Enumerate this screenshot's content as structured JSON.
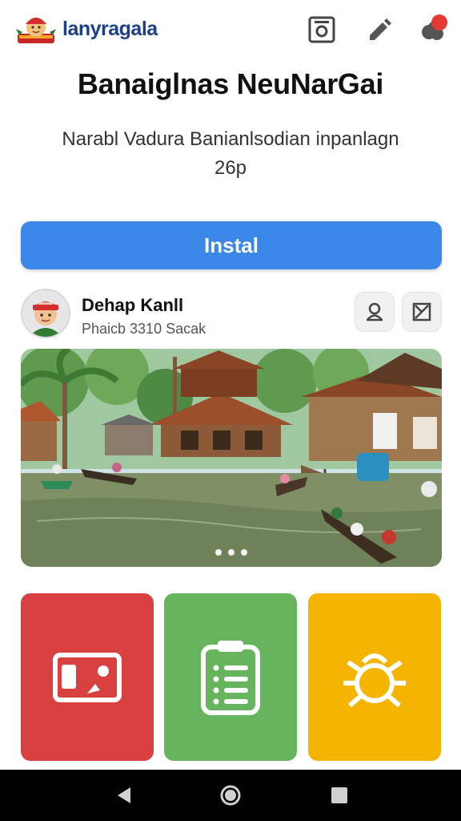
{
  "app": {
    "brand_name": "lanyragala",
    "title": "Banaiglnas NeuNarGai",
    "subtitle": "Narabl Vadura Banianlsodian inpanlagn 26p"
  },
  "install": {
    "label": "Instal"
  },
  "developer": {
    "name": "Dehap Kanll",
    "meta": "Phaicb 3310 Sacak"
  },
  "hero": {
    "slides": 3,
    "active_slide": 1
  },
  "icons": {
    "top": [
      "camera-icon",
      "pen-icon",
      "notification-icon"
    ],
    "actions": [
      "person-icon",
      "share-icon"
    ],
    "tiles": [
      "image-icon",
      "clipboard-list-icon",
      "bug-icon"
    ],
    "nav": [
      "back-icon",
      "home-icon",
      "recents-icon"
    ]
  },
  "colors": {
    "accent": "#3b87e8",
    "brand_text": "#1e3f8a",
    "tile_red": "#d94040",
    "tile_green": "#66b45c",
    "tile_yellow": "#f4b400",
    "badge": "#e53935"
  }
}
